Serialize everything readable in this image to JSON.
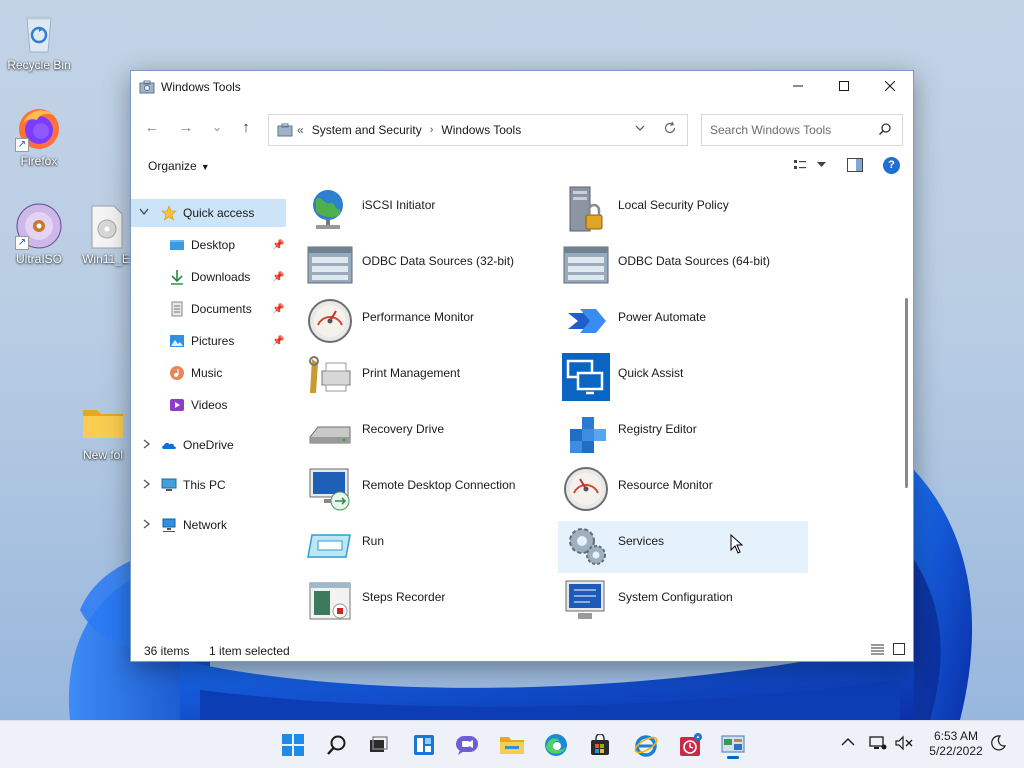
{
  "desktop": {
    "icons": [
      {
        "label": "Recycle Bin",
        "icon": "recycle-bin-icon"
      },
      {
        "label": "Firefox",
        "icon": "firefox-icon"
      },
      {
        "label": "UltraISO",
        "icon": "ultraiso-disc-icon"
      },
      {
        "label": "Win11_E",
        "icon": "iso-file-icon"
      },
      {
        "label": "New fol",
        "icon": "folder-icon"
      }
    ]
  },
  "window": {
    "title": "Windows Tools",
    "nav": {
      "back": "←",
      "forward": "→",
      "recent": "⌄",
      "up": "↑"
    },
    "address": {
      "overflow": "«",
      "crumbs": [
        "System and Security",
        "Windows Tools"
      ],
      "separator": "›"
    },
    "search": {
      "placeholder": "Search Windows Tools"
    },
    "command_bar": {
      "organize_label": "Organize",
      "help": "?"
    },
    "navigation_pane": {
      "quick_access": "Quick access",
      "pinned": [
        {
          "label": "Desktop",
          "icon": "desktop-icon",
          "pinned": true
        },
        {
          "label": "Downloads",
          "icon": "downloads-icon",
          "pinned": true
        },
        {
          "label": "Documents",
          "icon": "documents-icon",
          "pinned": true
        },
        {
          "label": "Pictures",
          "icon": "pictures-icon",
          "pinned": true
        },
        {
          "label": "Music",
          "icon": "music-icon",
          "pinned": false
        },
        {
          "label": "Videos",
          "icon": "videos-icon",
          "pinned": false
        }
      ],
      "roots": [
        {
          "label": "OneDrive",
          "icon": "onedrive-icon"
        },
        {
          "label": "This PC",
          "icon": "this-pc-icon"
        },
        {
          "label": "Network",
          "icon": "network-icon"
        }
      ]
    },
    "files": [
      {
        "name": "iSCSI Initiator",
        "icon": "iscsi-globe-icon"
      },
      {
        "name": "Local Security Policy",
        "icon": "security-policy-icon"
      },
      {
        "name": "ODBC Data Sources (32-bit)",
        "icon": "odbc-icon"
      },
      {
        "name": "ODBC Data Sources (64-bit)",
        "icon": "odbc-icon"
      },
      {
        "name": "Performance Monitor",
        "icon": "gauge-icon"
      },
      {
        "name": "Power Automate",
        "icon": "power-automate-icon"
      },
      {
        "name": "Print Management",
        "icon": "printer-icon"
      },
      {
        "name": "Quick Assist",
        "icon": "quick-assist-icon"
      },
      {
        "name": "Recovery Drive",
        "icon": "drive-icon"
      },
      {
        "name": "Registry Editor",
        "icon": "registry-icon"
      },
      {
        "name": "Remote Desktop Connection",
        "icon": "remote-desktop-icon"
      },
      {
        "name": "Resource Monitor",
        "icon": "gauge-icon"
      },
      {
        "name": "Run",
        "icon": "run-icon"
      },
      {
        "name": "Services",
        "icon": "gears-icon",
        "selected": true
      },
      {
        "name": "Steps Recorder",
        "icon": "steps-recorder-icon"
      },
      {
        "name": "System Configuration",
        "icon": "system-config-icon"
      }
    ],
    "status": {
      "item_count": "36 items",
      "selection": "1 item selected"
    }
  },
  "taskbar": {
    "apps": [
      "start-icon",
      "search-icon",
      "task-view-icon",
      "widgets-icon",
      "chat-icon",
      "file-explorer-icon",
      "edge-icon",
      "store-icon",
      "internet-explorer-icon",
      "alarms-icon",
      "control-panel-icon"
    ],
    "time": "6:53 AM",
    "date": "5/22/2022",
    "tray_chevron": "^"
  },
  "colors": {
    "accent": "#0067c0",
    "selection": "#cce4f7",
    "hover": "#e5f1fb"
  }
}
